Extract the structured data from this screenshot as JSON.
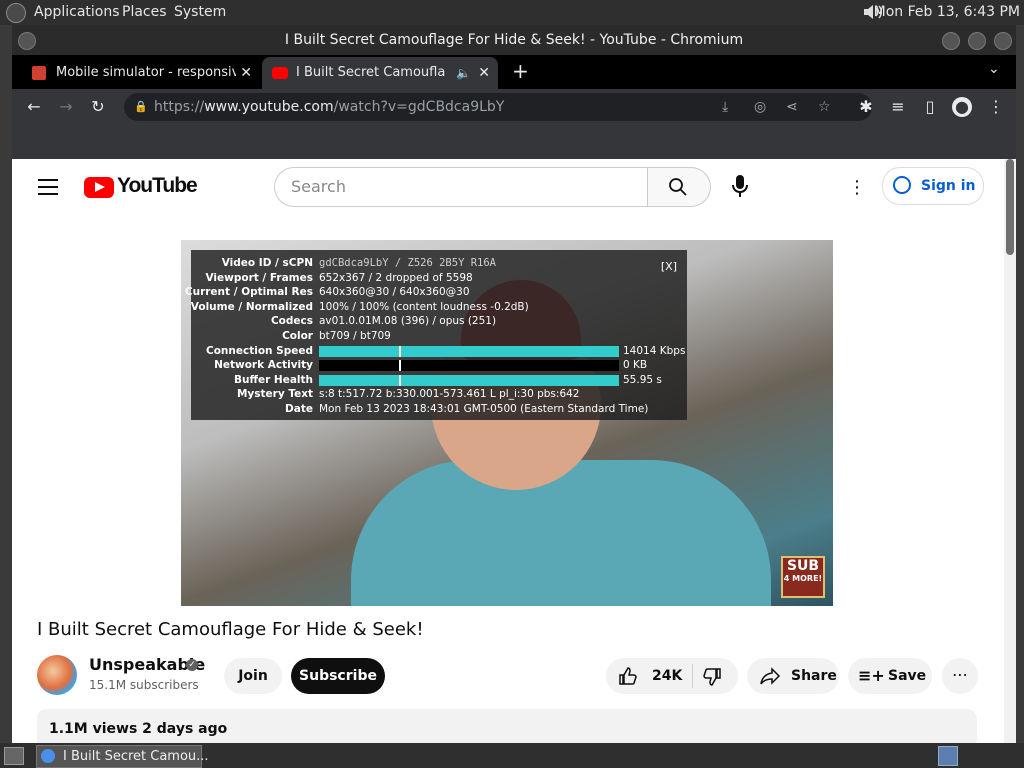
{
  "os_panel": {
    "menu": [
      "Applications",
      "Places",
      "System"
    ],
    "clock": "Mon Feb 13,  6:43 PM"
  },
  "window": {
    "title": "I Built Secret Camouflage For Hide & Seek! - YouTube - Chromium"
  },
  "tabs": [
    {
      "label": "Mobile simulator - responsive",
      "active": false
    },
    {
      "label": "I Built Secret Camouflage",
      "active": true
    }
  ],
  "toolbar": {
    "url_prefix": "https://",
    "url_host": "www.youtube.com",
    "url_path": "/watch?v=gdCBdca9LbY"
  },
  "youtube": {
    "logo_text": "YouTube",
    "search_placeholder": "Search",
    "signin_label": "Sign in"
  },
  "stats": {
    "close": "[X]",
    "rows": [
      {
        "key": "Video ID / sCPN",
        "value": "gdCBdca9LbY / Z526 2B5Y R16A"
      },
      {
        "key": "Viewport / Frames",
        "value": "652x367 / 2 dropped of 5598"
      },
      {
        "key": "Current / Optimal Res",
        "value": "640x360@30 / 640x360@30"
      },
      {
        "key": "Volume / Normalized",
        "value": "100% / 100% (content loudness -0.2dB)"
      },
      {
        "key": "Codecs",
        "value": "av01.0.01M.08 (396) / opus (251)"
      },
      {
        "key": "Color",
        "value": "bt709 / bt709"
      },
      {
        "key": "Connection Speed",
        "bar_label": "14014 Kbps",
        "fill": 1.0,
        "color": "#3cc"
      },
      {
        "key": "Network Activity",
        "bar_label": "0 KB",
        "fill": 0.0,
        "color": "#fff"
      },
      {
        "key": "Buffer Health",
        "bar_label": "55.95 s",
        "fill": 1.0,
        "color": "#3cc"
      },
      {
        "key": "Mystery Text",
        "value": "s:8 t:517.72 b:330.001-573.461 L pl_i:30 pbs:642"
      },
      {
        "key": "Date",
        "value": "Mon Feb 13 2023 18:43:01 GMT-0500 (Eastern Standard Time)"
      }
    ]
  },
  "video": {
    "badge_top": "SUB",
    "badge_bottom": "4 MORE!",
    "title": "I Built Secret Camouflage For Hide & Seek!",
    "channel": "Unspeakable",
    "subscribers": "15.1M subscribers",
    "join_label": "Join",
    "subscribe_label": "Subscribe",
    "likes": "24K",
    "share_label": "Share",
    "save_label": "Save",
    "views_date": "1.1M views  2 days ago"
  },
  "taskbar": {
    "window_label": "I Built Secret Camou..."
  }
}
